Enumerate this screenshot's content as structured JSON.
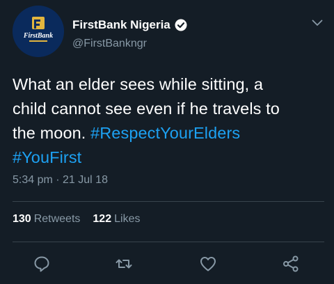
{
  "author": {
    "display_name": "FirstBank Nigeria",
    "handle": "@FirstBankngr",
    "avatar_label": "FirstBank",
    "verified": true
  },
  "tweet": {
    "text_lines": [
      "What an elder sees while sitting, a",
      "child cannot see even if he travels to",
      "the moon."
    ],
    "hashtags": [
      "#RespectYourElders",
      "#YouFirst"
    ],
    "timestamp": "5:34 pm · 21 Jul 18"
  },
  "stats": {
    "retweets_count": "130",
    "retweets_label": "Retweets",
    "likes_count": "122",
    "likes_label": "Likes"
  },
  "colors": {
    "background": "#141d26",
    "accent": "#1da1f2",
    "muted": "#8899a6"
  },
  "icons": {
    "reply": "reply-icon",
    "retweet": "retweet-icon",
    "like": "heart-icon",
    "share": "share-icon"
  }
}
